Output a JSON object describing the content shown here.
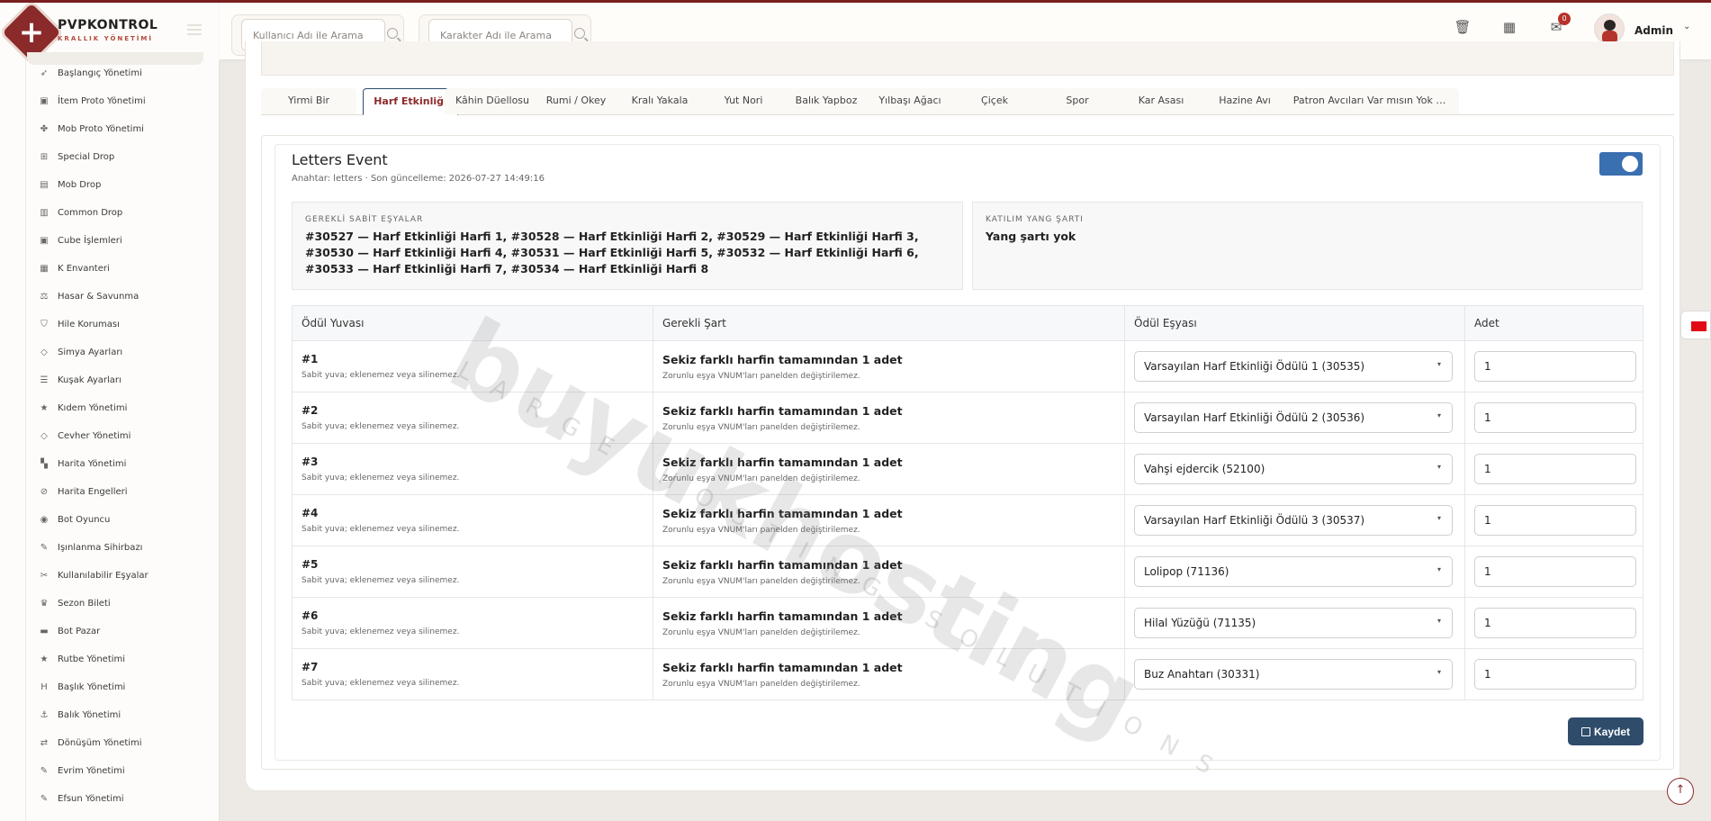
{
  "brand": {
    "name": "PVPKONTROL",
    "subtitle": "KRALLIK YÖNETİMİ"
  },
  "sidebar": {
    "items": [
      {
        "label": "Başlangıç Yönetimi",
        "icon": "rocket-icon",
        "glyph": "➶"
      },
      {
        "label": "İtem Proto Yönetimi",
        "icon": "cube-icon",
        "glyph": "▣"
      },
      {
        "label": "Mob Proto Yönetimi",
        "icon": "paw-icon",
        "glyph": "✤"
      },
      {
        "label": "Special Drop",
        "icon": "gift-icon",
        "glyph": "⊞"
      },
      {
        "label": "Mob Drop",
        "icon": "box-icon",
        "glyph": "▤"
      },
      {
        "label": "Common Drop",
        "icon": "box-open-icon",
        "glyph": "▥"
      },
      {
        "label": "Cube İşlemleri",
        "icon": "cube-icon",
        "glyph": "▣"
      },
      {
        "label": "K Envanteri",
        "icon": "archive-icon",
        "glyph": "▦"
      },
      {
        "label": "Hasar & Savunma",
        "icon": "scale-icon",
        "glyph": "⚖"
      },
      {
        "label": "Hile Koruması",
        "icon": "shield-icon",
        "glyph": "⛉"
      },
      {
        "label": "Simya Ayarları",
        "icon": "gem-icon",
        "glyph": "◇"
      },
      {
        "label": "Kuşak Ayarları",
        "icon": "sliders-icon",
        "glyph": "☰"
      },
      {
        "label": "Kıdem Yönetimi",
        "icon": "star-icon",
        "glyph": "★"
      },
      {
        "label": "Cevher Yönetimi",
        "icon": "gem-icon",
        "glyph": "◇"
      },
      {
        "label": "Harita Yönetimi",
        "icon": "map-icon",
        "glyph": "▚"
      },
      {
        "label": "Harita Engelleri",
        "icon": "ban-icon",
        "glyph": "⊘"
      },
      {
        "label": "Bot Oyuncu",
        "icon": "robot-icon",
        "glyph": "◉"
      },
      {
        "label": "Işınlanma Sihirbazı",
        "icon": "magic-icon",
        "glyph": "✎"
      },
      {
        "label": "Kullanılabilir Eşyalar",
        "icon": "tools-icon",
        "glyph": "✂"
      },
      {
        "label": "Sezon Bileti",
        "icon": "trophy-icon",
        "glyph": "♛"
      },
      {
        "label": "Bot Pazar",
        "icon": "shop-icon",
        "glyph": "▬"
      },
      {
        "label": "Rutbe Yönetimi",
        "icon": "star-icon",
        "glyph": "★"
      },
      {
        "label": "Başlık Yönetimi",
        "icon": "heading-icon",
        "glyph": "H"
      },
      {
        "label": "Balık Yönetimi",
        "icon": "anchor-icon",
        "glyph": "⚓"
      },
      {
        "label": "Dönüşüm Yönetimi",
        "icon": "shuffle-icon",
        "glyph": "⇄"
      },
      {
        "label": "Evrim Yönetimi",
        "icon": "magic-icon",
        "glyph": "✎"
      },
      {
        "label": "Efsun Yönetimi",
        "icon": "wand-icon",
        "glyph": "✎"
      }
    ]
  },
  "header": {
    "search_user_placeholder": "Kullanıcı Adı ile Arama",
    "search_char_placeholder": "Karakter Adı ile Arama",
    "notification_count": "0",
    "admin_name": "Admin"
  },
  "tabs": [
    {
      "label": "Yirmi Bir"
    },
    {
      "label": "Harf Etkinliği",
      "active": true
    },
    {
      "label": "Kâhin Düellosu"
    },
    {
      "label": "Rumi / Okey"
    },
    {
      "label": "Kralı Yakala"
    },
    {
      "label": "Yut Nori"
    },
    {
      "label": "Balık Yapboz"
    },
    {
      "label": "Yılbaşı Ağacı"
    },
    {
      "label": "Çiçek"
    },
    {
      "label": "Spor"
    },
    {
      "label": "Kar Asası"
    },
    {
      "label": "Hazine Avı"
    },
    {
      "label": "Patron Avcıları"
    },
    {
      "label": "Var mısın Yok musun"
    }
  ],
  "event": {
    "title": "Letters Event",
    "meta": "Anahtar: letters · Son güncelleme: 2026-07-27 14:49:16",
    "enabled": true,
    "required_label": "GEREKLİ SABİT EŞYALAR",
    "required_value": "#30527 — Harf Etkinliği Harfi 1, #30528 — Harf Etkinliği Harfi 2, #30529 — Harf Etkinliği Harfi 3, #30530 — Harf Etkinliği Harfi 4, #30531 — Harf Etkinliği Harfi 5, #30532 — Harf Etkinliği Harfi 6, #30533 — Harf Etkinliği Harfi 7, #30534 — Harf Etkinliği Harfi 8",
    "yang_label": "KATILIM YANG ŞARTI",
    "yang_value": "Yang şartı yok"
  },
  "table": {
    "headers": {
      "slot": "Ödül Yuvası",
      "condition": "Gerekli Şart",
      "reward": "Ödül Eşyası",
      "qty": "Adet"
    },
    "rows": [
      {
        "slot": "#1",
        "slot_note": "Sabit yuva; eklenemez veya silinemez.",
        "cond": "Sekiz farklı harfin tamamından 1 adet",
        "cond_note": "Zorunlu eşya VNUM'ları panelden değiştirilemez.",
        "reward": "Varsayılan Harf Etkinliği Ödülü 1 (30535)",
        "qty": "1"
      },
      {
        "slot": "#2",
        "slot_note": "Sabit yuva; eklenemez veya silinemez.",
        "cond": "Sekiz farklı harfin tamamından 1 adet",
        "cond_note": "Zorunlu eşya VNUM'ları panelden değiştirilemez.",
        "reward": "Varsayılan Harf Etkinliği Ödülü 2 (30536)",
        "qty": "1"
      },
      {
        "slot": "#3",
        "slot_note": "Sabit yuva; eklenemez veya silinemez.",
        "cond": "Sekiz farklı harfin tamamından 1 adet",
        "cond_note": "Zorunlu eşya VNUM'ları panelden değiştirilemez.",
        "reward": "Vahşi ejdercik (52100)",
        "qty": "1"
      },
      {
        "slot": "#4",
        "slot_note": "Sabit yuva; eklenemez veya silinemez.",
        "cond": "Sekiz farklı harfin tamamından 1 adet",
        "cond_note": "Zorunlu eşya VNUM'ları panelden değiştirilemez.",
        "reward": "Varsayılan Harf Etkinliği Ödülü 3 (30537)",
        "qty": "1"
      },
      {
        "slot": "#5",
        "slot_note": "Sabit yuva; eklenemez veya silinemez.",
        "cond": "Sekiz farklı harfin tamamından 1 adet",
        "cond_note": "Zorunlu eşya VNUM'ları panelden değiştirilemez.",
        "reward": "Lolipop (71136)",
        "qty": "1"
      },
      {
        "slot": "#6",
        "slot_note": "Sabit yuva; eklenemez veya silinemez.",
        "cond": "Sekiz farklı harfin tamamından 1 adet",
        "cond_note": "Zorunlu eşya VNUM'ları panelden değiştirilemez.",
        "reward": "Hilal Yüzüğü (71135)",
        "qty": "1"
      },
      {
        "slot": "#7",
        "slot_note": "Sabit yuva; eklenemez veya silinemez.",
        "cond": "Sekiz farklı harfin tamamından 1 adet",
        "cond_note": "Zorunlu eşya VNUM'ları panelden değiştirilemez.",
        "reward": "Buz Anahtarı (30331)",
        "qty": "1"
      }
    ]
  },
  "save_label": "Kaydet",
  "watermark": {
    "main": "buyukhosting",
    "sub": "LARGE HOSTING SOLUTIONS"
  },
  "colors": {
    "brand": "#8b2a2a",
    "primary": "#2f4c6b",
    "toggle_on": "#3a6fb0"
  }
}
